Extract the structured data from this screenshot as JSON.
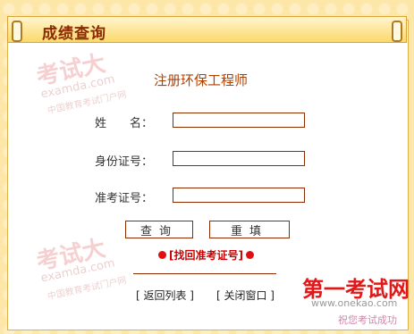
{
  "title": "成绩查询",
  "subtitle": "注册环保工程师",
  "form": {
    "name_label": "姓　　名：",
    "id_label": "身份证号：",
    "ticket_label": "准考证号："
  },
  "buttons": {
    "query": "查询",
    "reset": "重填"
  },
  "find_ticket_link": "[找回准考证号]",
  "footer": {
    "back_list": "[ 返回列表 ]",
    "close_window": "[ 关闭窗口 ]"
  },
  "watermarks": {
    "logo_text": "考试大",
    "logo_url": "examda.com",
    "logo_caption": "中国教育考试门户网"
  },
  "brand": {
    "name": "第一考试网",
    "url": "www.onekao.com",
    "slogan": "祝您考试成功"
  }
}
